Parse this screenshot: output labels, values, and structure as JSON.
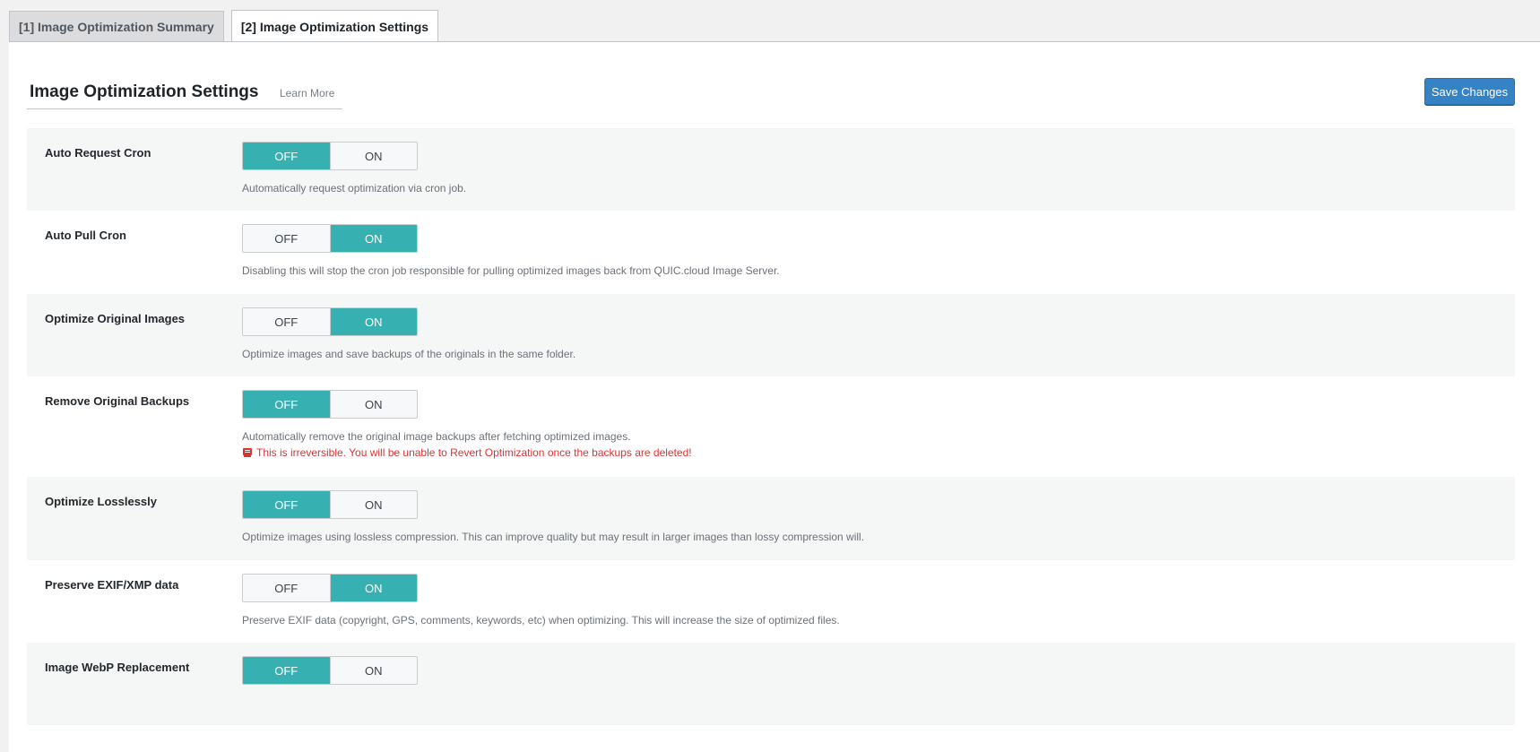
{
  "tabs": [
    {
      "label": "[1] Image Optimization Summary",
      "active": false
    },
    {
      "label": "[2] Image Optimization Settings",
      "active": true
    }
  ],
  "header": {
    "title": "Image Optimization Settings",
    "learn_more": "Learn More",
    "save_label": "Save Changes"
  },
  "toggle_labels": {
    "off": "OFF",
    "on": "ON"
  },
  "colors": {
    "toggle_active": "#36b0b0",
    "save_button": "#3582c4",
    "warning": "#dc3232",
    "row_alt": "#f5f6f6"
  },
  "settings": [
    {
      "label": "Auto Request Cron",
      "value": "OFF",
      "description": "Automatically request optimization via cron job."
    },
    {
      "label": "Auto Pull Cron",
      "value": "ON",
      "description": "Disabling this will stop the cron job responsible for pulling optimized images back from QUIC.cloud Image Server."
    },
    {
      "label": "Optimize Original Images",
      "value": "ON",
      "description": "Optimize images and save backups of the originals in the same folder."
    },
    {
      "label": "Remove Original Backups",
      "value": "OFF",
      "description": "Automatically remove the original image backups after fetching optimized images.",
      "warning": "This is irreversible. You will be unable to Revert Optimization once the backups are deleted!",
      "warning_icon": "warning-icon"
    },
    {
      "label": "Optimize Losslessly",
      "value": "OFF",
      "description": "Optimize images using lossless compression. This can improve quality but may result in larger images than lossy compression will."
    },
    {
      "label": "Preserve EXIF/XMP data",
      "value": "ON",
      "description": "Preserve EXIF data (copyright, GPS, comments, keywords, etc) when optimizing. This will increase the size of optimized files."
    },
    {
      "label": "Image WebP Replacement",
      "value": "OFF",
      "description": ""
    }
  ]
}
